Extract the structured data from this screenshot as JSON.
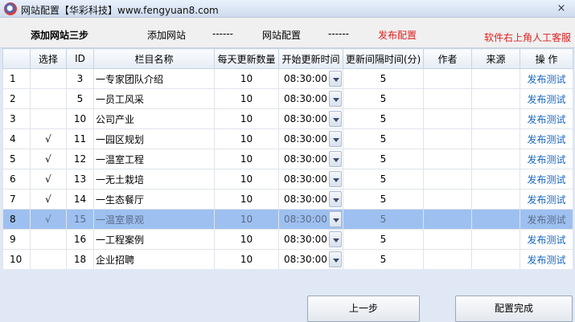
{
  "window": {
    "title": "网站配置【华彩科技】www.fengyuan8.com",
    "close_label": "×"
  },
  "steps": {
    "title": "添加网站三步",
    "step1": "添加网站",
    "sep1": "------",
    "step2": "网站配置",
    "sep2": "------",
    "step3": "发布配置",
    "help": "软件右上角人工客服"
  },
  "table": {
    "headers": [
      "",
      "选择",
      "ID",
      "栏目名称",
      "每天更新数量",
      "开始更新时间",
      "更新间隔时间(分)",
      "作者",
      "来源",
      "操 作"
    ],
    "rows": [
      {
        "num": "1",
        "check": "",
        "id": "3",
        "name": "一专家团队介绍",
        "count": "10",
        "time": "08:30:00",
        "interval": "5",
        "author": "",
        "source": "",
        "action": "发布测试"
      },
      {
        "num": "2",
        "check": "",
        "id": "5",
        "name": "一员工风采",
        "count": "10",
        "time": "08:30:00",
        "interval": "5",
        "author": "",
        "source": "",
        "action": "发布测试"
      },
      {
        "num": "3",
        "check": "",
        "id": "10",
        "name": "公司产业",
        "count": "10",
        "time": "08:30:00",
        "interval": "5",
        "author": "",
        "source": "",
        "action": "发布测试"
      },
      {
        "num": "4",
        "check": "√",
        "id": "11",
        "name": "一园区规划",
        "count": "10",
        "time": "08:30:00",
        "interval": "5",
        "author": "",
        "source": "",
        "action": "发布测试"
      },
      {
        "num": "5",
        "check": "√",
        "id": "12",
        "name": "一温室工程",
        "count": "10",
        "time": "08:30:00",
        "interval": "5",
        "author": "",
        "source": "",
        "action": "发布测试"
      },
      {
        "num": "6",
        "check": "√",
        "id": "13",
        "name": "一无土栽培",
        "count": "10",
        "time": "08:30:00",
        "interval": "5",
        "author": "",
        "source": "",
        "action": "发布测试"
      },
      {
        "num": "7",
        "check": "√",
        "id": "14",
        "name": "一生态餐厅",
        "count": "10",
        "time": "08:30:00",
        "interval": "5",
        "author": "",
        "source": "",
        "action": "发布测试"
      },
      {
        "num": "8",
        "check": "√",
        "id": "15",
        "name": "一温室景观",
        "count": "10",
        "time": "08:30:00",
        "interval": "5",
        "author": "",
        "source": "",
        "action": "发布测试"
      },
      {
        "num": "9",
        "check": "",
        "id": "16",
        "name": "一工程案例",
        "count": "10",
        "time": "08:30:00",
        "interval": "5",
        "author": "",
        "source": "",
        "action": "发布测试"
      },
      {
        "num": "10",
        "check": "",
        "id": "18",
        "name": "企业招聘",
        "count": "10",
        "time": "08:30:00",
        "interval": "5",
        "author": "",
        "source": "",
        "action": "发布测试"
      }
    ],
    "selected_index": 7
  },
  "buttons": {
    "prev": "上一步",
    "done": "配置完成"
  }
}
